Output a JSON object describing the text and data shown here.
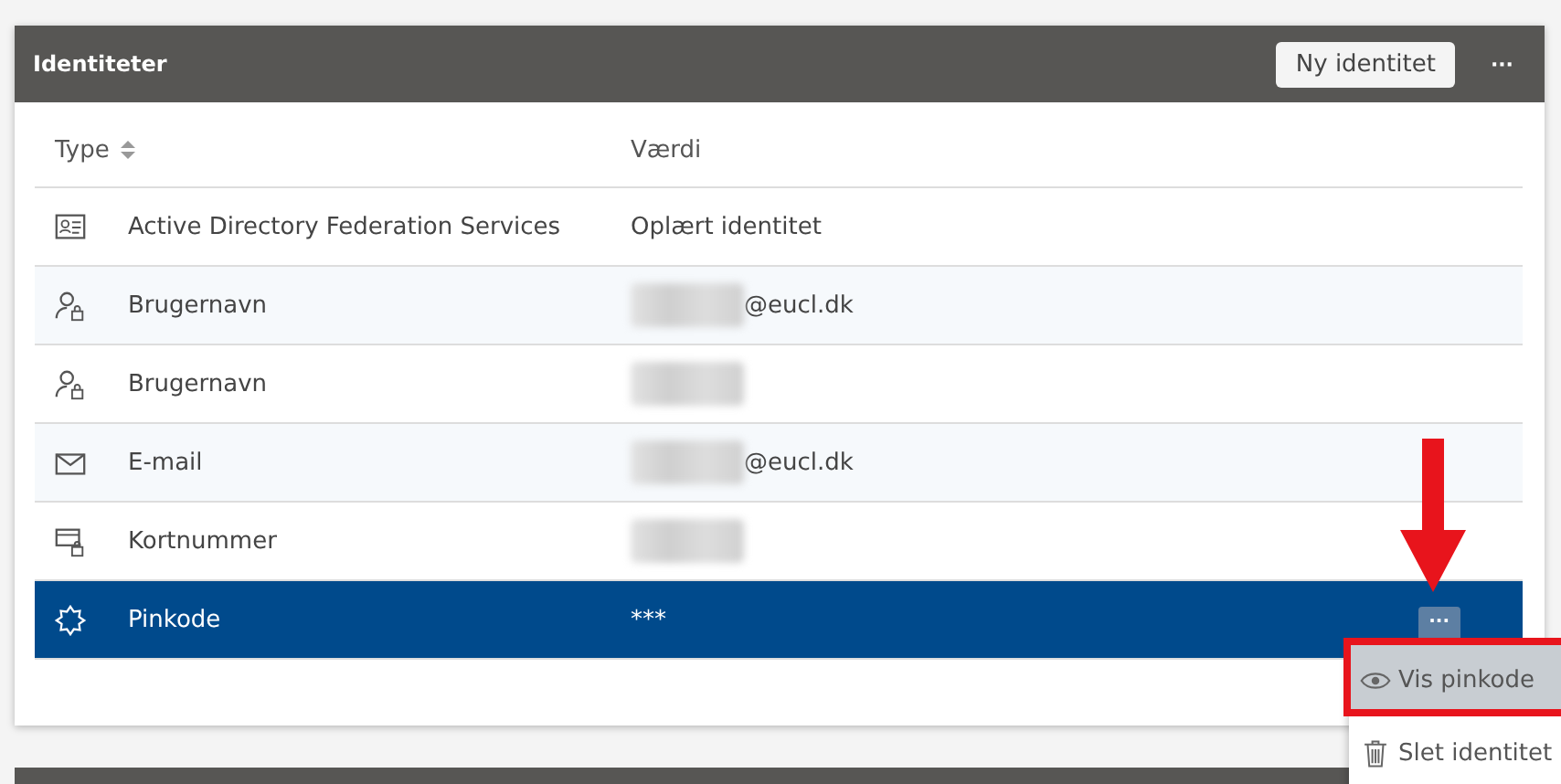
{
  "panel": {
    "title": "Identiteter",
    "new_button": "Ny identitet",
    "more_button": "···"
  },
  "table": {
    "columns": [
      {
        "label": "Type",
        "sortable": true
      },
      {
        "label": "Værdi",
        "sortable": false
      }
    ],
    "rows": [
      {
        "kind": "adfs",
        "type": "Active Directory Federation Services",
        "value": "Oplært identitet",
        "redacted": false,
        "selected": false
      },
      {
        "kind": "username",
        "type": "Brugernavn",
        "value": "@eucl.dk",
        "redacted": true,
        "selected": false
      },
      {
        "kind": "username",
        "type": "Brugernavn",
        "redacted": true,
        "selected": false
      },
      {
        "kind": "email",
        "type": "E-mail",
        "value": "@eucl.dk",
        "redacted": true,
        "selected": false
      },
      {
        "kind": "card",
        "type": "Kortnummer",
        "redacted": true,
        "selected": false
      },
      {
        "kind": "pin",
        "type": "Pinkode",
        "value": "***",
        "redacted": false,
        "selected": true,
        "row_menu": "···"
      }
    ]
  },
  "context_menu": {
    "items": [
      {
        "kind": "view",
        "label": "Vis pinkode",
        "selected": true
      },
      {
        "kind": "delete",
        "label": "Slet identitet",
        "selected": false
      }
    ]
  }
}
